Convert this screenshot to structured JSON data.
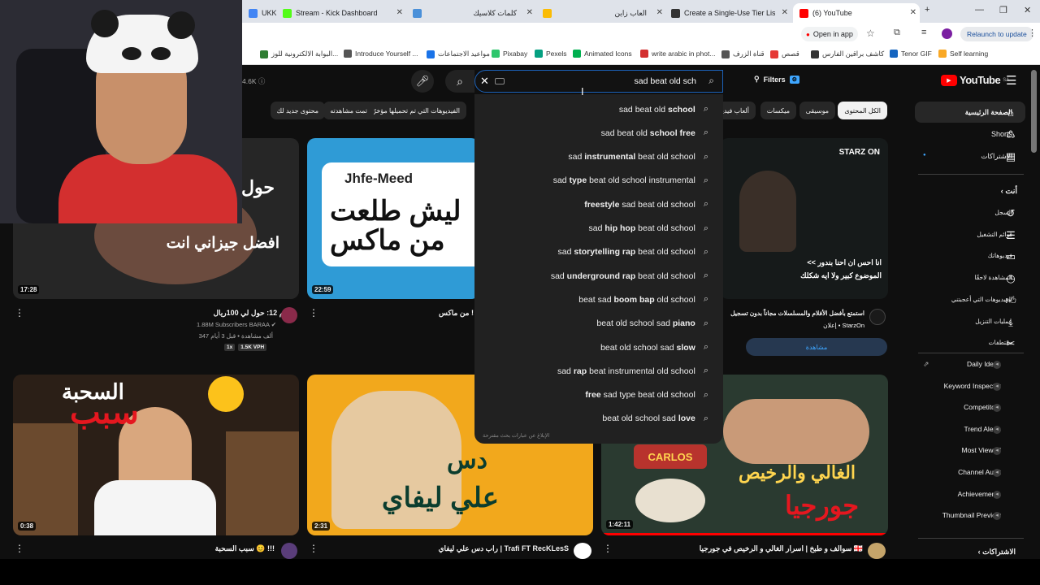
{
  "browser": {
    "tabs": [
      {
        "label": "UKK",
        "color": "#4285f4"
      },
      {
        "label": "Stream - Kick Dashboard",
        "color": "#53fc18"
      },
      {
        "label": "كلمات كلاسيك",
        "color": "#4a90d9"
      },
      {
        "label": "",
        "color": "#fbbc04"
      },
      {
        "label": "العاب زاين",
        "color": "#ffffff"
      },
      {
        "label": "Create a Single-Use Tier List (F",
        "color": "#333333"
      },
      {
        "label": "(6) YouTube",
        "color": "#ff0000"
      }
    ],
    "new_tab": "+",
    "open_in_app": "Open in app",
    "relaunch": "Relaunch to update",
    "bookmarks": [
      {
        "label": "البوابة الالكترونية للوز...",
        "color": "#2e7d32"
      },
      {
        "label": "Introduce Yourself ...",
        "color": "#555555"
      },
      {
        "label": "مواعيد الاجتماعات",
        "color": "#1a73e8"
      },
      {
        "label": "Pixabay",
        "color": "#2ec66d"
      },
      {
        "label": "Pexels",
        "color": "#05a081"
      },
      {
        "label": "Animated Icons",
        "color": "#00b050"
      },
      {
        "label": "write arabic in phot...",
        "color": "#d32f2f"
      },
      {
        "label": "قناة الزرف",
        "color": "#555555"
      },
      {
        "label": "قصص",
        "color": "#e53935"
      },
      {
        "label": "كاشف براقين الفارس",
        "color": "#333333"
      },
      {
        "label": "Tenor GIF",
        "color": "#1565c0"
      },
      {
        "label": "Self learning",
        "color": "#f9a825"
      }
    ]
  },
  "youtube": {
    "logo": "YouTube",
    "logo_suffix": "SA",
    "filters": "Filters",
    "views_chip": "4.6K",
    "search": {
      "query": "sad beat old sch",
      "report": "الإبلاغ عن عبارات بحث مقترحة",
      "suggestions": [
        {
          "pre": "sad beat old ",
          "bold": "school"
        },
        {
          "pre": "sad beat old ",
          "bold": "school free"
        },
        {
          "pre": "sad ",
          "bold": "instrumental",
          "post": " beat old school"
        },
        {
          "pre": "sad ",
          "bold": "type",
          "post": " beat old school instrumental"
        },
        {
          "pre": "",
          "bold": "freestyle",
          "post": " sad beat old school"
        },
        {
          "pre": "sad ",
          "bold": "hip hop",
          "post": " beat old school"
        },
        {
          "pre": "sad ",
          "bold": "storytelling rap",
          "post": " beat old school"
        },
        {
          "pre": "sad ",
          "bold": "underground rap",
          "post": " beat old school"
        },
        {
          "pre": "beat sad ",
          "bold": "boom bap",
          "post": " old school"
        },
        {
          "pre": "beat old school sad ",
          "bold": "piano"
        },
        {
          "pre": "beat old school sad ",
          "bold": "slow"
        },
        {
          "pre": "sad ",
          "bold": "rap",
          "post": " beat instrumental old school"
        },
        {
          "pre": "",
          "bold": "free",
          "post": " sad type beat old school"
        },
        {
          "pre": "beat old school sad ",
          "bold": "love"
        }
      ]
    },
    "chips": [
      "الكل المحتوى",
      "موسيقى",
      "ميكسات",
      "ألعاب فيديو",
      "الفيديوهات التي تم تحميلها مؤخرًا",
      "تمت مشاهدته",
      "محتوى جديد لك"
    ],
    "sidebar": {
      "main": [
        "الصفحة الرئيسية",
        "Shorts",
        "الاشتراكات"
      ],
      "you_header": "أنت",
      "you_items": [
        "السجل",
        "قوائم التشغيل",
        "فيديوهاتك",
        "المشاهدة لاحقًا",
        "الفيديوهات التي أعجبتني",
        "عمليات التنزيل",
        "مقتطفات"
      ],
      "tools": [
        "Daily Ideas",
        "Keyword Inspector",
        "Competitors",
        "Trend Alerts",
        "Most Viewed",
        "Channel Audit",
        "Achievements",
        "Thumbnail Preview"
      ],
      "subs_header": "الاشتراكات"
    },
    "videos": [
      {
        "title": "رأيكم 12: حول لي 100ريال",
        "channel": "BARAA",
        "subs": "1.88M Subscribers",
        "stats": "347 ألف مشاهدة • قبل 3 أيام",
        "badge1": "1x",
        "badge2": "1.5K VPH",
        "duration": "17:28",
        "thumb_text_1": "حول",
        "thumb_text_2": "افضل جيزاني انت"
      },
      {
        "title": "من ماكس !",
        "duration": "22:59",
        "thumb_text_1": "ليش طلعت",
        "thumb_text_2": "من ماكس",
        "thumb_handle": "Jhfe-Meed"
      },
      {
        "title": "استمتع بأفضل الأفلام والمسلسلات مجاناً بدون تسجيل",
        "channel": "StarzOn",
        "ad": "إعلان •",
        "ad_button": "مشاهدة",
        "thumb_text_1": "<< انا احس ان احنا بندور",
        "thumb_text_2": "الموضوع كبير ولا ايه شكلك",
        "brand": "STARZ ON"
      },
      {
        "title": "سبب السحبة 😊 !!!",
        "duration": "0:38",
        "thumb_text_1": "السحبة",
        "thumb_text_2": "سبب"
      },
      {
        "title": "راب دس علي ليفاي | Trafi FT RecKLesS",
        "duration": "2:31",
        "thumb_text_1": "دس",
        "thumb_text_2": "علي ليفاي"
      },
      {
        "title": "سوالف و طبخ | اسرار الغالي و الرخيص في جورجيا 🇬🇪",
        "duration": "1:42:11",
        "thumb_text_1": "الغالي والرخيص",
        "thumb_text_2": "جورجيا",
        "thumb_sign": "CARLOS"
      }
    ]
  },
  "colors": {
    "accent": "#3ea6ff",
    "brand": "#ff0000",
    "bg": "#0f0f0f"
  }
}
